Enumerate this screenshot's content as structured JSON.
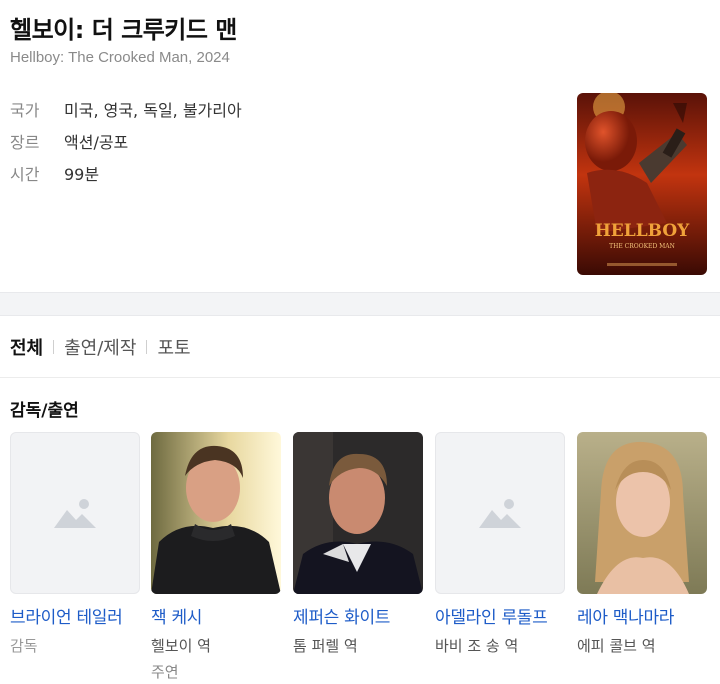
{
  "movie": {
    "title": "헬보이: 더 크루키드 맨",
    "subtitle": "Hellboy: The Crooked Man, 2024",
    "info": [
      {
        "label": "국가",
        "value": "미국, 영국, 독일, 불가리아"
      },
      {
        "label": "장르",
        "value": "액션/공포"
      },
      {
        "label": "시간",
        "value": "99분"
      }
    ],
    "poster": {
      "title": "HELLBOY",
      "subtitle": "THE CROOKED MAN"
    }
  },
  "tabs": [
    {
      "label": "전체",
      "active": true
    },
    {
      "label": "출연/제작",
      "active": false
    },
    {
      "label": "포토",
      "active": false
    }
  ],
  "section_title": "감독/출연",
  "cast": [
    {
      "name": "브라이언 테일러",
      "role": "감독",
      "role2": "",
      "photo": "placeholder"
    },
    {
      "name": "잭 케시",
      "role": "헬보이 역",
      "role2": "주연",
      "photo": "man-1"
    },
    {
      "name": "제퍼슨 화이트",
      "role": "톰 퍼렐 역",
      "role2": "",
      "photo": "man-2"
    },
    {
      "name": "아델라인 루돌프",
      "role": "바비 조 송 역",
      "role2": "",
      "photo": "placeholder"
    },
    {
      "name": "레아 맥나마라",
      "role": "에피 콜브 역",
      "role2": "",
      "photo": "woman-1"
    }
  ],
  "colors": {
    "link": "#1e5cc8",
    "band": "#f3f4f6",
    "label": "#888888"
  }
}
